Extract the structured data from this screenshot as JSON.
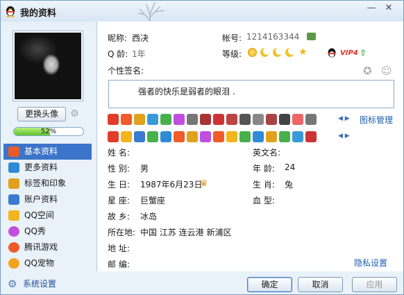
{
  "window": {
    "title": "我的资料",
    "min_glyph": "—",
    "close_glyph": "✕"
  },
  "left": {
    "change_avatar_label": "更换头像",
    "progress_value": 0.52,
    "progress_text": "52%",
    "nav_items": [
      {
        "label": "基本资料",
        "icon": "card-icon",
        "color": "#e85b2b"
      },
      {
        "label": "更多资料",
        "icon": "form-icon",
        "color": "#2f8bd6"
      },
      {
        "label": "标签和印象",
        "icon": "tag-icon",
        "color": "#e2a11d"
      },
      {
        "label": "账户资料",
        "icon": "account-icon",
        "color": "#3a7bd0"
      },
      {
        "label": "QQ空间",
        "icon": "star-icon",
        "color": "#f2b51d"
      },
      {
        "label": "QQ秀",
        "icon": "qqshow-icon",
        "color": "#c04fe0"
      },
      {
        "label": "腾讯游戏",
        "icon": "game-icon",
        "color": "#ef5b29"
      },
      {
        "label": "QQ宠物",
        "icon": "pet-icon",
        "color": "#f3a31b"
      }
    ],
    "settings_label": "系统设置"
  },
  "profile": {
    "nickname_label": "昵称:",
    "nickname": "西决",
    "account_label": "帐号:",
    "account": "1214163344",
    "qage_label": "Q 龄:",
    "qage": "1年",
    "level_label": "等级:",
    "vip_text": "VIP4",
    "signature_label": "个性签名:",
    "signature": "强者的快乐是弱者的眼泪 ."
  },
  "icon_rows": {
    "row1_colors": [
      "#e33b2a",
      "#ef5b29",
      "#e2a11d",
      "#3a9ad9",
      "#46b14a",
      "#c04fe0",
      "#777",
      "#a33",
      "#c33",
      "#b44",
      "#555",
      "#888",
      "#a44",
      "#444",
      "#e66",
      "#777"
    ],
    "row2_colors": [
      "#e33b2a",
      "#f2b51d",
      "#3a7bd0",
      "#46b14a",
      "#2f8bd6",
      "#ef5b29",
      "#e2a11d",
      "#c04fe0",
      "#ef5b29",
      "#f2b51d",
      "#46b14a",
      "#2f8bd6",
      "#e2a11d",
      "#46b14a",
      "#3a9ad9",
      "#c33"
    ],
    "manage_label": "图标管理"
  },
  "details": {
    "name_label": "姓    名:",
    "english_name_label": "英文名:",
    "gender_label": "性    别:",
    "gender": "男",
    "age_label": "年    龄:",
    "age": "24",
    "birthday_label": "生    日:",
    "birthday": "1987年6月23日",
    "zodiac_label": "生    肖:",
    "zodiac": "兔",
    "constellation_label": "星    座:",
    "constellation": "巨蟹座",
    "blood_label": "血    型:",
    "hometown_label": "故    乡:",
    "hometown": "冰岛",
    "location_label": "所在地:",
    "location": "中国 江苏 连云港 新浦区",
    "address_label": "地    址:",
    "postcode_label": "邮    编:",
    "privacy_label": "隐私设置"
  },
  "buttons": {
    "ok": "确定",
    "cancel": "取消",
    "apply": "应用"
  }
}
